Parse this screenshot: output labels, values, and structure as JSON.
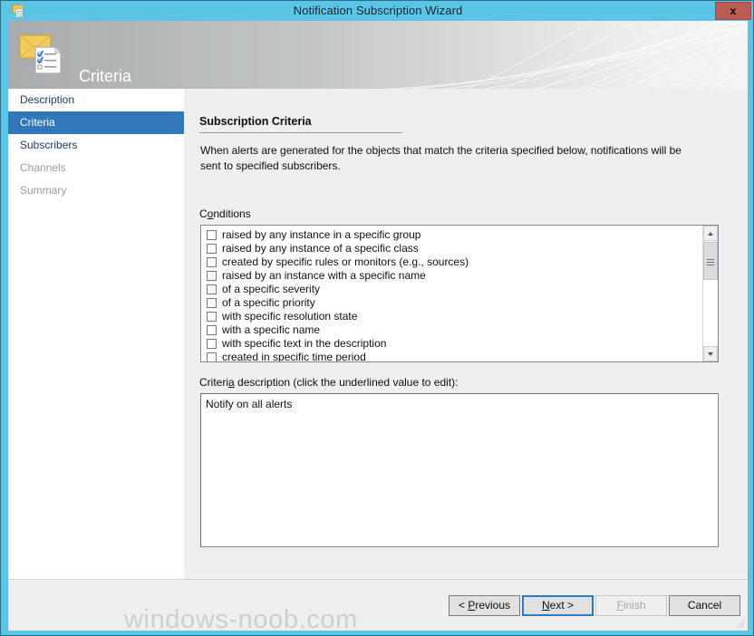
{
  "window": {
    "title": "Notification Subscription Wizard",
    "title_icon": "envelope-checklist-icon",
    "close_label": "x",
    "accent_blue": "#5bc5e8",
    "close_red": "#bb5b52"
  },
  "banner": {
    "title": "Criteria",
    "icon": "envelope-checklist-icon"
  },
  "sidebar": {
    "items": [
      {
        "label": "Description",
        "state": "enabled"
      },
      {
        "label": "Criteria",
        "state": "selected"
      },
      {
        "label": "Subscribers",
        "state": "enabled"
      },
      {
        "label": "Channels",
        "state": "disabled"
      },
      {
        "label": "Summary",
        "state": "disabled"
      }
    ],
    "selected_color": "#3277b8"
  },
  "main": {
    "section_title": "Subscription Criteria",
    "section_description": "When alerts are generated for the objects that match the criteria specified below, notifications will be sent to specified subscribers.",
    "conditions_label_pre": "C",
    "conditions_label_accel": "o",
    "conditions_label_post": "nditions",
    "conditions": [
      {
        "label": "raised by any instance in a specific group",
        "checked": false
      },
      {
        "label": "raised by any instance of a specific class",
        "checked": false
      },
      {
        "label": "created by specific rules or monitors (e.g., sources)",
        "checked": false
      },
      {
        "label": "raised by an instance with a specific name",
        "checked": false
      },
      {
        "label": "of a specific severity",
        "checked": false
      },
      {
        "label": "of a specific priority",
        "checked": false
      },
      {
        "label": "with specific resolution state",
        "checked": false
      },
      {
        "label": "with a specific name",
        "checked": false
      },
      {
        "label": "with specific text in the description",
        "checked": false
      },
      {
        "label": "created in specific time period",
        "checked": false
      }
    ],
    "criteria_desc_label_pre": "Criteri",
    "criteria_desc_label_accel": "a",
    "criteria_desc_label_post": " description (click the underlined value to edit):",
    "criteria_desc_value": "Notify on all alerts"
  },
  "footer": {
    "watermark": "windows-noob.com",
    "buttons": {
      "previous": {
        "pre": "< ",
        "accel": "P",
        "post": "revious",
        "state": "enabled"
      },
      "next": {
        "pre": "",
        "accel": "N",
        "post": "ext >",
        "state": "focused"
      },
      "finish": {
        "pre": "",
        "accel": "F",
        "post": "inish",
        "state": "disabled"
      },
      "cancel": {
        "pre": "Cancel",
        "accel": "",
        "post": "",
        "state": "enabled"
      }
    }
  }
}
